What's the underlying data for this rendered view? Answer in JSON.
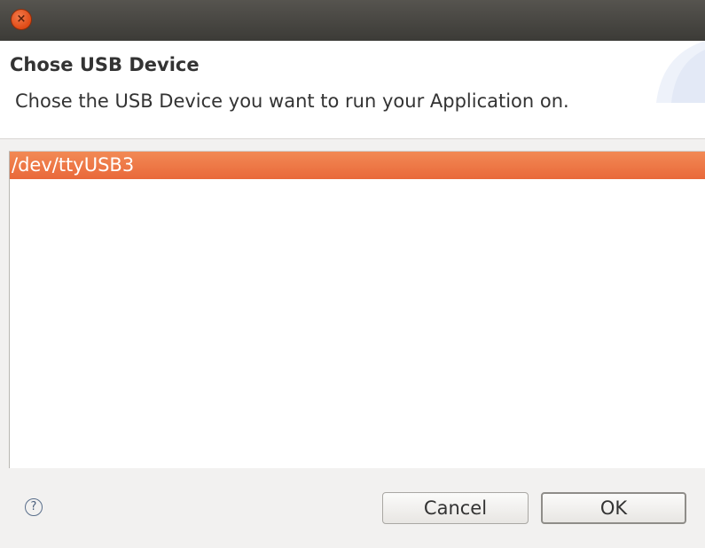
{
  "window": {
    "close_icon": "close-icon",
    "close_symbol": "×"
  },
  "header": {
    "title": "Chose USB Device",
    "description": "Chose the USB Device you want to run your Application on."
  },
  "device_list": {
    "items": [
      {
        "label": "/dev/ttyUSB3",
        "selected": true
      }
    ]
  },
  "footer": {
    "help_icon": "help-icon",
    "help_symbol": "?",
    "cancel_label": "Cancel",
    "ok_label": "OK"
  },
  "colors": {
    "selection": "#ee7a48",
    "titlebar": "#3c3b37",
    "close_button": "#df4a16"
  }
}
